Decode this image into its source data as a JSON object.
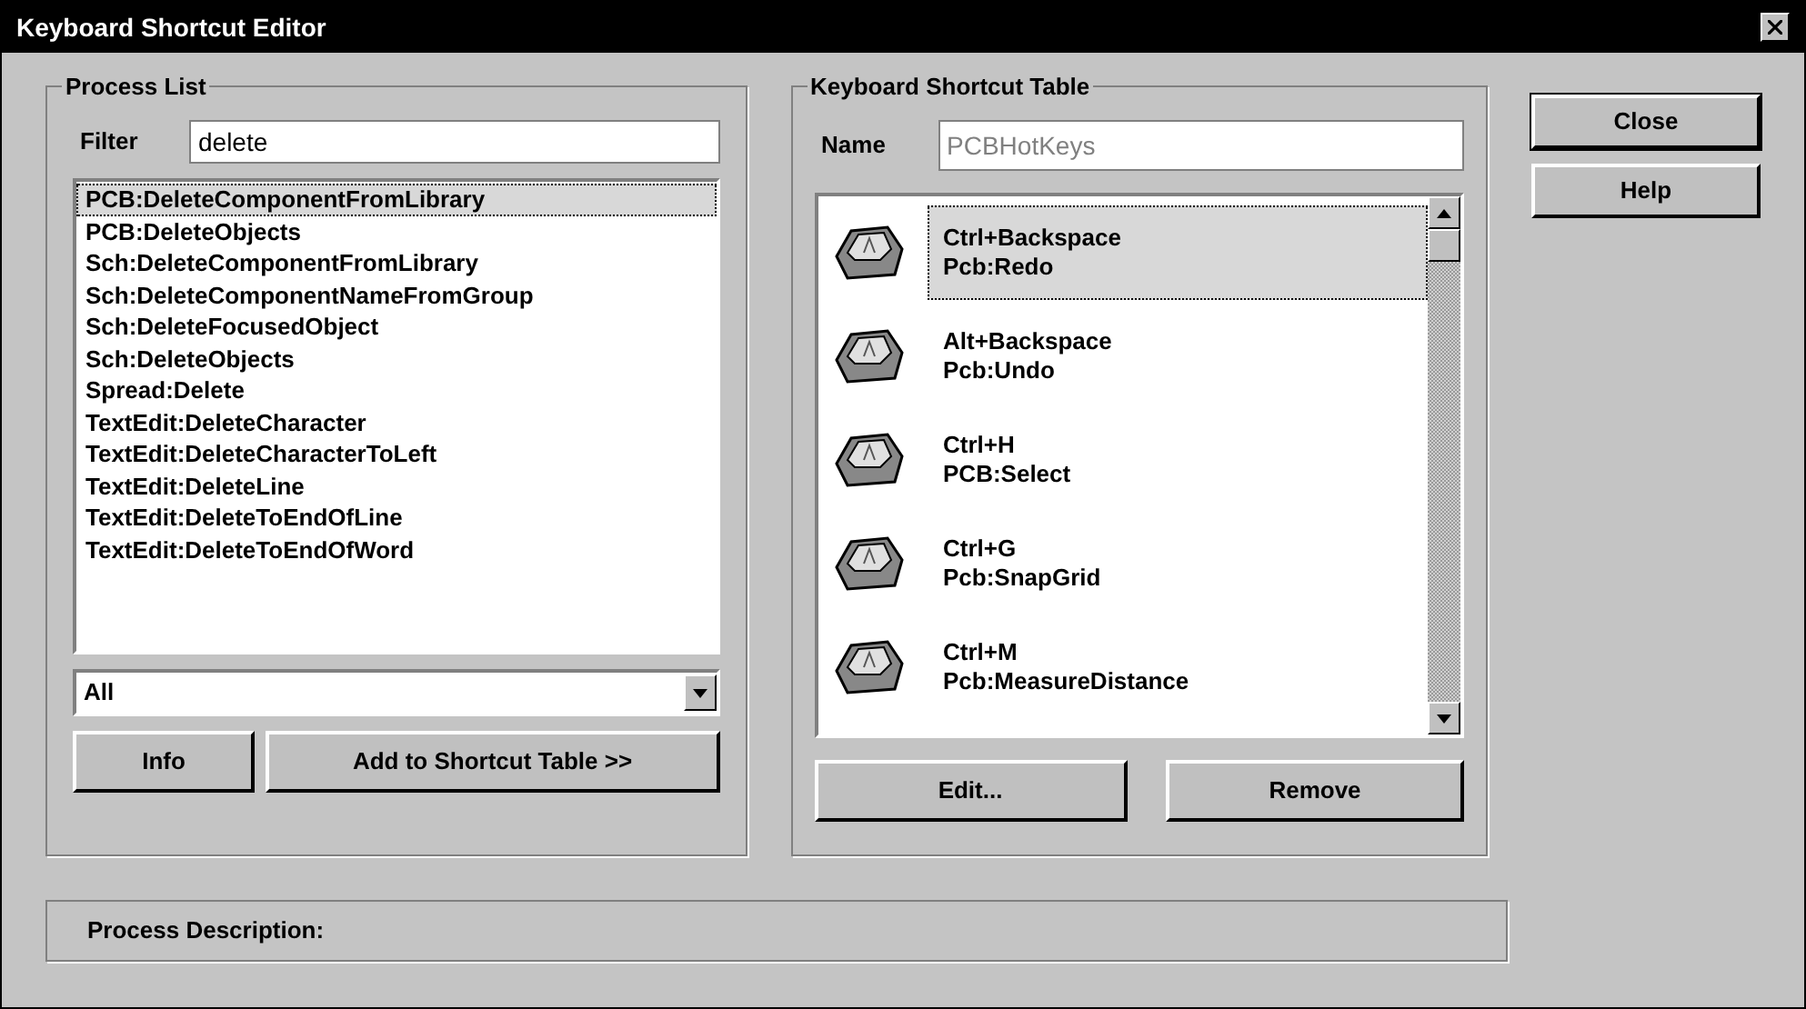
{
  "window": {
    "title": "Keyboard Shortcut Editor"
  },
  "process_list": {
    "title": "Process List",
    "filter": {
      "label": "Filter",
      "value": "delete"
    },
    "items": [
      {
        "label": "PCB:DeleteComponentFromLibrary",
        "selected": true
      },
      {
        "label": "PCB:DeleteObjects",
        "selected": false
      },
      {
        "label": "Sch:DeleteComponentFromLibrary",
        "selected": false
      },
      {
        "label": "Sch:DeleteComponentNameFromGroup",
        "selected": false
      },
      {
        "label": "Sch:DeleteFocusedObject",
        "selected": false
      },
      {
        "label": "Sch:DeleteObjects",
        "selected": false
      },
      {
        "label": "Spread:Delete",
        "selected": false
      },
      {
        "label": "TextEdit:DeleteCharacter",
        "selected": false
      },
      {
        "label": "TextEdit:DeleteCharacterToLeft",
        "selected": false
      },
      {
        "label": "TextEdit:DeleteLine",
        "selected": false
      },
      {
        "label": "TextEdit:DeleteToEndOfLine",
        "selected": false
      },
      {
        "label": "TextEdit:DeleteToEndOfWord",
        "selected": false
      }
    ],
    "category": {
      "value": "All"
    },
    "buttons": [
      "Info",
      "Add to Shortcut Table >>"
    ]
  },
  "shortcut_table": {
    "title": "Keyboard Shortcut Table",
    "name": {
      "label": "Name",
      "value": "PCBHotKeys",
      "disabled": true
    },
    "items": [
      {
        "keys": "Ctrl+Backspace",
        "process": "Pcb:Redo",
        "selected": true
      },
      {
        "keys": "Alt+Backspace",
        "process": "Pcb:Undo",
        "selected": false
      },
      {
        "keys": "Ctrl+H",
        "process": "PCB:Select",
        "selected": false
      },
      {
        "keys": "Ctrl+G",
        "process": "Pcb:SnapGrid",
        "selected": false
      },
      {
        "keys": "Ctrl+M",
        "process": "Pcb:MeasureDistance",
        "selected": false
      }
    ],
    "buttons": [
      "Edit...",
      "Remove"
    ]
  },
  "side_buttons": [
    "Close",
    "Help"
  ],
  "process_description": {
    "label": "Process Description:"
  }
}
